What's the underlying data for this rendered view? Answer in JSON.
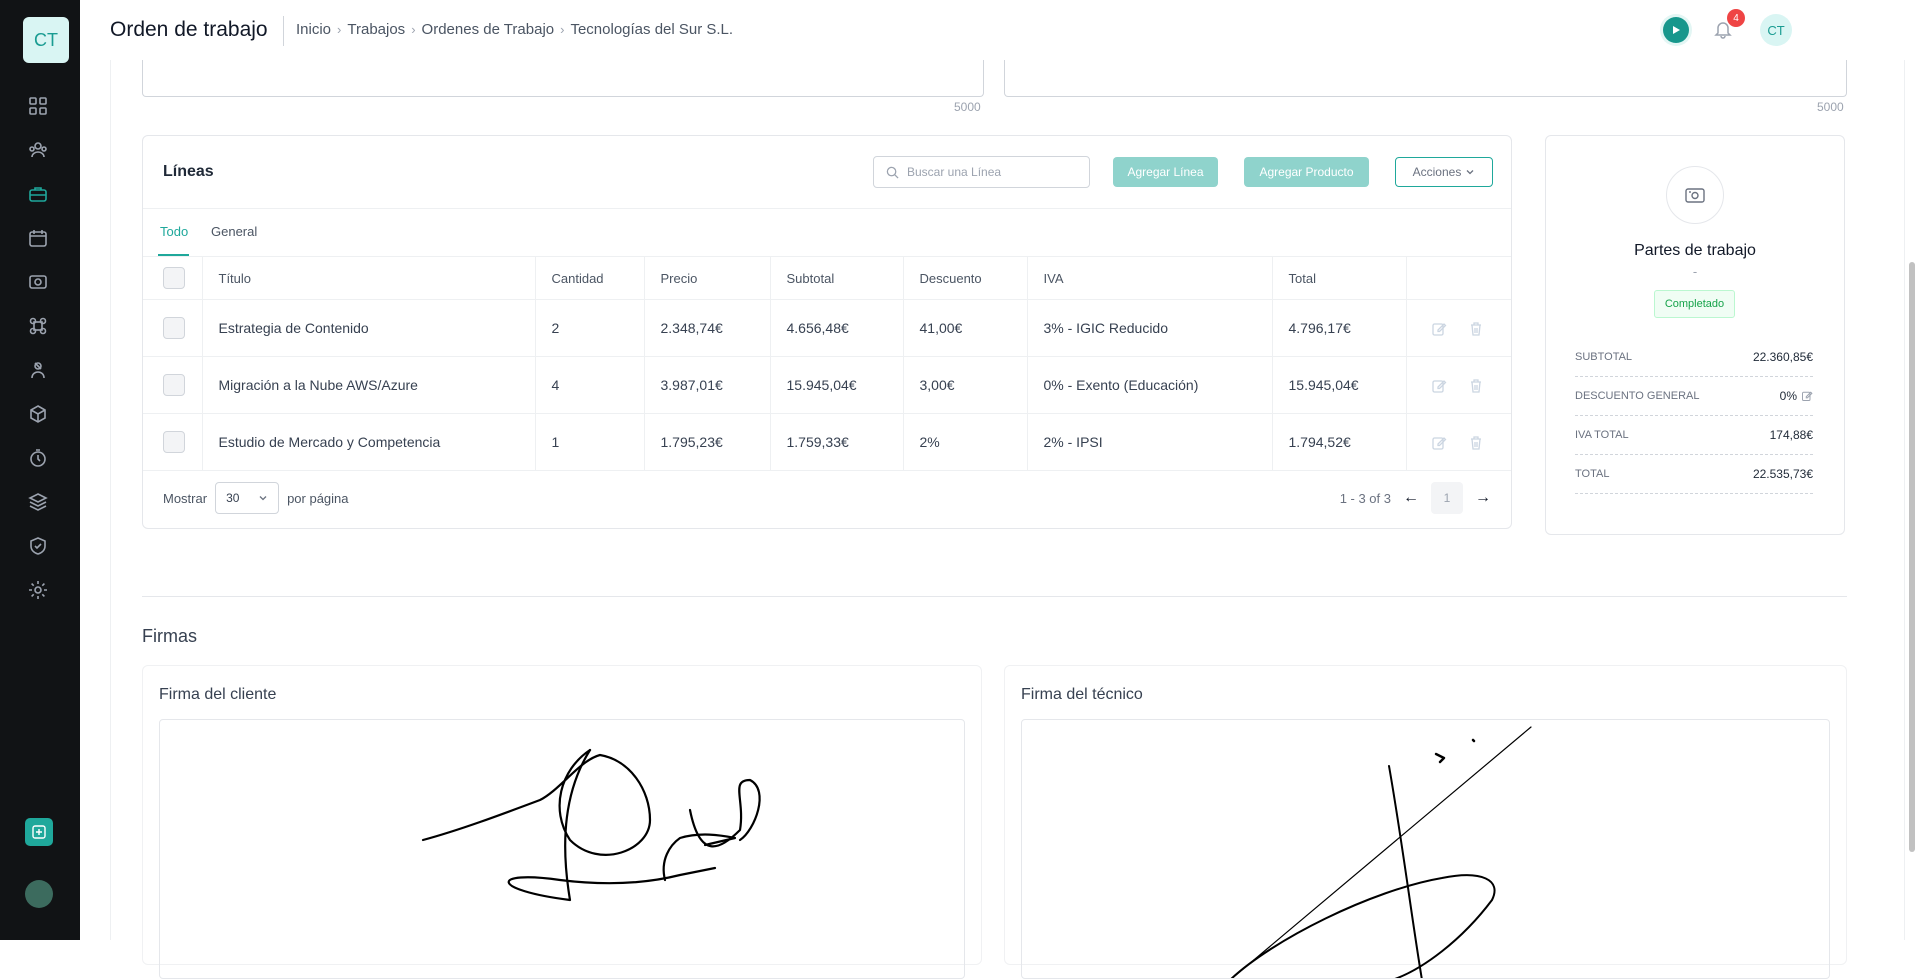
{
  "app": {
    "logo_text": "CT",
    "user_initials": "CT",
    "notifications_count": "4"
  },
  "header": {
    "title": "Orden de trabajo",
    "breadcrumb": [
      "Inicio",
      "Trabajos",
      "Ordenes de Trabajo",
      "Tecnologías del Sur S.L."
    ]
  },
  "sidebar": {
    "icons": [
      "dashboard-icon",
      "clients-icon",
      "work-icon",
      "calendar-icon",
      "camera-icon",
      "modules-icon",
      "tech-icon",
      "integrations-icon",
      "timer-icon",
      "layers-icon",
      "shield-icon",
      "settings-icon"
    ],
    "active": "work-icon"
  },
  "textareas": {
    "left_counter": "5000",
    "right_counter": "5000"
  },
  "lines": {
    "title": "Líneas",
    "search_placeholder": "Buscar una Línea",
    "add_line": "Agregar Línea",
    "add_product": "Agregar Producto",
    "actions": "Acciones",
    "tabs": [
      "Todo",
      "General"
    ],
    "columns": [
      "Título",
      "Cantidad",
      "Precio",
      "Subtotal",
      "Descuento",
      "IVA",
      "Total"
    ],
    "rows": [
      {
        "title": "Estrategia de Contenido",
        "qty": "2",
        "price": "2.348,74€",
        "subtotal": "4.656,48€",
        "discount": "41,00€",
        "iva": "3% - IGIC Reducido",
        "total": "4.796,17€"
      },
      {
        "title": "Migración a la Nube AWS/Azure",
        "qty": "4",
        "price": "3.987,01€",
        "subtotal": "15.945,04€",
        "discount": "3,00€",
        "iva": "0% - Exento (Educación)",
        "total": "15.945,04€"
      },
      {
        "title": "Estudio de Mercado y Competencia",
        "qty": "1",
        "price": "1.795,23€",
        "subtotal": "1.759,33€",
        "discount": "2%",
        "iva": "2% - IPSI",
        "total": "1.794,52€"
      }
    ],
    "show_label": "Mostrar",
    "per_page_value": "30",
    "per_page_label": "por página",
    "range": "1 - 3 of 3",
    "current_page": "1"
  },
  "parts": {
    "title": "Partes de trabajo",
    "dash": "-",
    "status": "Completado",
    "status_color": "#16a34a",
    "summary": [
      {
        "label": "SUBTOTAL",
        "value": "22.360,85€"
      },
      {
        "label": "DESCUENTO GENERAL",
        "value": "0%"
      },
      {
        "label": "IVA TOTAL",
        "value": "174,88€"
      },
      {
        "label": "TOTAL",
        "value": "22.535,73€"
      }
    ]
  },
  "signatures": {
    "title": "Firmas",
    "client": "Firma del cliente",
    "technician": "Firma del técnico"
  },
  "colors": {
    "accent": "#1fa89b",
    "sidebar_bg": "#111315",
    "badge": "#ef4444"
  }
}
